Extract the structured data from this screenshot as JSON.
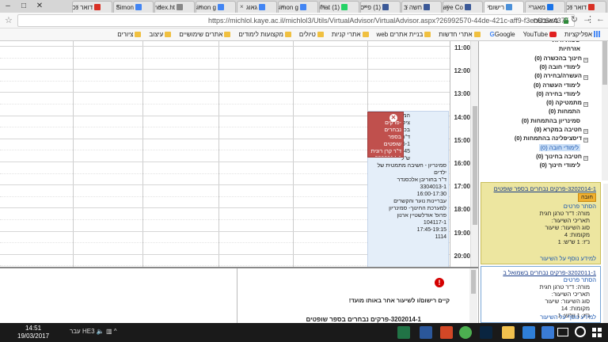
{
  "browser": {
    "tabs": [
      {
        "label": "דואר נכנ",
        "color": "#d93025",
        "active": false
      },
      {
        "label": "מאגר",
        "color": "#1a73e8",
        "active": false
      },
      {
        "label": "רישום",
        "color": "#4a90d9",
        "active": true
      },
      {
        "label": "Kaye Co",
        "color": "#3b5998",
        "active": false
      },
      {
        "label": "חשה ב",
        "color": "#3b5998",
        "active": false
      },
      {
        "label": "(1) פייס",
        "color": "#3b5998",
        "active": false
      },
      {
        "label": "(1) What",
        "color": "#25d366",
        "active": false
      },
      {
        "label": "simon g",
        "color": "#4285f4",
        "active": false
      },
      {
        "label": "גאוג",
        "color": "#4285f4",
        "active": false
      },
      {
        "label": "simon g",
        "color": "#4285f4",
        "active": false
      },
      {
        "label": "index.ht",
        "color": "#888888",
        "active": false
      },
      {
        "label": "Simon",
        "color": "#4285f4",
        "active": false
      },
      {
        "label": "דואר נכ",
        "color": "#d93025",
        "active": false
      }
    ],
    "address": {
      "security_label": "מאובטח",
      "url": "https://michlol.kaye.ac.il/michlol3/Utils/VirtualAdvisor/VirtualAdvisor.aspx?26992570-44de-421c-aff9-f3ec6b6e4375"
    },
    "bookmarks": [
      {
        "label": "אפליקציות",
        "icon": "apps"
      },
      {
        "label": "YouTube",
        "icon": "youtube"
      },
      {
        "label": "Google",
        "icon": "google"
      },
      {
        "label": "אתרי חדשות",
        "icon": "folder"
      },
      {
        "label": "בניית אתרים web",
        "icon": "folder"
      },
      {
        "label": "אתרי קניות",
        "icon": "folder"
      },
      {
        "label": "טיולים",
        "icon": "folder"
      },
      {
        "label": "מקצועות לימודים",
        "icon": "folder"
      },
      {
        "label": "אתרים שימושיים",
        "icon": "folder"
      },
      {
        "label": "עיצוב",
        "icon": "folder"
      },
      {
        "label": "ציורים",
        "icon": "folder"
      }
    ]
  },
  "calendar": {
    "hours": [
      "11:00",
      "12:00",
      "13:00",
      "14:00",
      "15:00",
      "16:00",
      "17:00",
      "18:00",
      "19:00",
      "20:00"
    ],
    "events": {
      "red": {
        "lines": [
          "-פרקים נבחרים",
          "בספר שופטים",
          "ד\"ר קרן רונית",
          "3202014-1",
          "14:15-15:45",
          "ש\"ל"
        ]
      },
      "blue": {
        "lines": [
          "המקרא באומה,",
          "ציליל ונמאה",
          "בכתובים",
          "ד\"ר קרן אורלי",
          "3282036-1",
          "14:15-15:45",
          "ש\"ל",
          "סמינריון - חשיבה מתמטית של",
          "ילדים",
          "ד\"ר בחוריבן אלכסנדר",
          "3304013-1",
          "16:00-17:30",
          "עבריינות נוער והקשרים",
          "למערכת החינוך- סמינריון",
          "פרופ' אודלשטיין ארנון",
          "104117-1",
          "17:45-19:15",
          "1114"
        ]
      }
    }
  },
  "tree": {
    "items": [
      {
        "label": "שפות זרות",
        "type": "leaf"
      },
      {
        "label": "אזרחיות",
        "type": "leaf"
      },
      {
        "label": "חינוך בהכשרה (0)",
        "type": "group"
      },
      {
        "label": "לימודי חובה (0)",
        "type": "leaf"
      },
      {
        "label": "העשרה/בחירה (0)",
        "type": "group"
      },
      {
        "label": "לימודי העשרה (0)",
        "type": "leaf"
      },
      {
        "label": "לימודי בחירה (0)",
        "type": "leaf"
      },
      {
        "label": "מתמטיקה (0)",
        "type": "group"
      },
      {
        "label": "התמחות (0)",
        "type": "leaf"
      },
      {
        "label": "סמינריון בהתמחות (0)",
        "type": "leaf"
      },
      {
        "label": "חטיבה במקרא (0)",
        "type": "group"
      },
      {
        "label": "דיסציפלינה בהתמחות (0)",
        "type": "group"
      },
      {
        "label": "לימודי חובה (0)",
        "type": "selected"
      },
      {
        "label": "חטיבה בחינוך (0)",
        "type": "group"
      },
      {
        "label": "לימודי חינוך (0)",
        "type": "leaf"
      }
    ]
  },
  "cards": [
    {
      "title": "3202014-1-פרקים נבחרים בספר שופטים",
      "badge": "חובה",
      "hide_link": "הסתר פרטים",
      "lines": [
        "מורה: ד\"ר טרגן חגית",
        "תאריכי השיעור:",
        "סוג השיעור: שיעור",
        "מקומות: 4",
        "נ\"ז: 1 ש\"ש: 1"
      ],
      "footer": "למידע נוסף על השיעור"
    },
    {
      "title": "3202011-1-פרקים נבחרים בשמואל ב",
      "hide_link": "הסתר פרטים",
      "lines": [
        "מורה: ד\"ר טרגן חגית",
        "תאריכי השיעור:",
        "סוג השיעור: שיעור",
        "מקומות: 14",
        "נ\"ז: 1 ש\"ש: 1"
      ],
      "footer": "למידע נוסף על השיעור"
    }
  ],
  "alert": {
    "message": "קיים רישום/ו לשיעור אחר באותו מועד!",
    "course_title": "3202014-1-פרקים נבחרים בספר שופטים"
  },
  "taskbar": {
    "time": "14:51",
    "date": "19/03/2017",
    "lang": "HE3",
    "lang2": "עבר",
    "apps": [
      "chrome",
      "photoshop",
      "file-explorer",
      "edge",
      "word",
      "powerpoint",
      "excel",
      "store"
    ]
  }
}
